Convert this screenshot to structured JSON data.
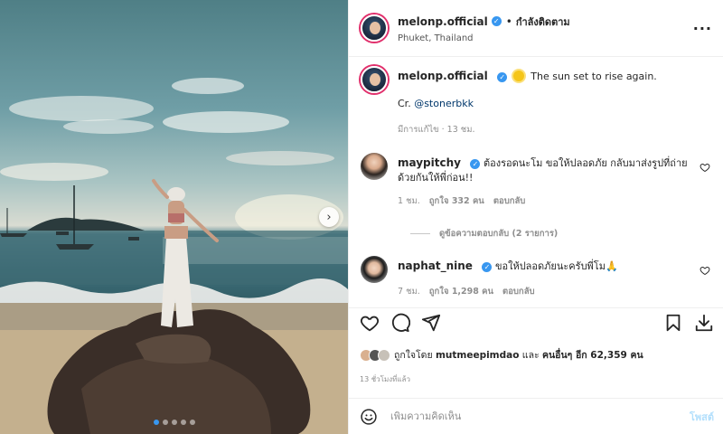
{
  "photo": {
    "next_icon": "chevron-right-icon",
    "carousel_dots": 5,
    "active_dot": 0
  },
  "header": {
    "username": "melonp.official",
    "separator": "•",
    "follow_label": "กำลังติดตาม",
    "location": "Phuket, Thailand",
    "more_icon": "more-options-icon",
    "more_label": "···"
  },
  "caption": {
    "username": "melonp.official",
    "text_line1": "The sun set to rise again.",
    "text_line2": "Cr.",
    "mention": "@stonerbkk",
    "meta": "มีการแก้ไข · 13 ชม."
  },
  "comments": [
    {
      "username": "maypitchy",
      "text": "ต้องรอดนะโม ขอให้ปลอดภัย กลับมาส่งรูปที่ถ่ายด้วยกันให้พี่ก่อน!!",
      "time": "1 ชม.",
      "likes": "ถูกใจ 332 คน",
      "reply_label": "ตอบกลับ"
    },
    {
      "username": "naphat_nine",
      "text": "ขอให้ปลอดภัยนะครับพี่โม🙏",
      "time": "7 ชม.",
      "likes": "ถูกใจ 1,298 คน",
      "reply_label": "ตอบกลับ"
    }
  ],
  "view_replies": "ดูข้อความตอบกลับ (2 รายการ)",
  "likes_summary": {
    "prefix": "ถูกใจโดย",
    "user": "mutmeepimdao",
    "conj": "และ",
    "others": "คนอื่นๆ อีก 62,359 คน"
  },
  "time_ago": "13 ชั่วโมงที่แล้ว",
  "composer": {
    "placeholder": "เพิ่มความคิดเห็น",
    "post_label": "โพสต์"
  },
  "colors": {
    "verified": "#3897f0",
    "link": "#00376b",
    "post_disabled": "#b2dffc"
  }
}
